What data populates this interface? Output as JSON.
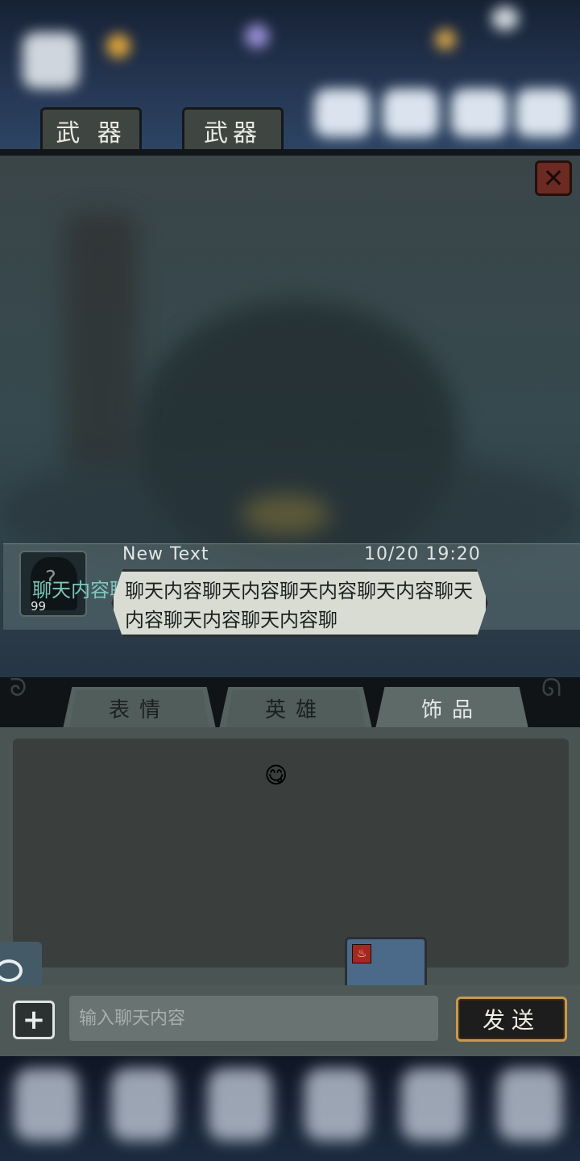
{
  "header": {
    "tabs": [
      {
        "label": "武 器"
      },
      {
        "label": "武器"
      }
    ]
  },
  "chat": {
    "close_icon": "close-icon",
    "message": {
      "sender": "New Text",
      "timestamp": "10/20 19:20",
      "avatar_level": "99",
      "overflow_text": "聊天内容聊天内容聊天内容聊天内容聊天内容聊天",
      "bubble_text": "聊天内容聊天内容聊天内容聊天内容聊天内容聊天内容聊天内容聊"
    }
  },
  "panel": {
    "tabs": [
      {
        "label": "表情"
      },
      {
        "label": "英雄"
      },
      {
        "label": "饰品"
      }
    ],
    "emoji": "😋"
  },
  "input": {
    "placeholder": "输入聊天内容",
    "value": "",
    "send_label": "发送",
    "plus_icon": "plus-icon"
  },
  "colors": {
    "send_border": "#c89a4b",
    "close_bg": "#6b2a22",
    "bubble_bg": "#d9dcd2",
    "overflow_text": "#7fd0c4"
  }
}
